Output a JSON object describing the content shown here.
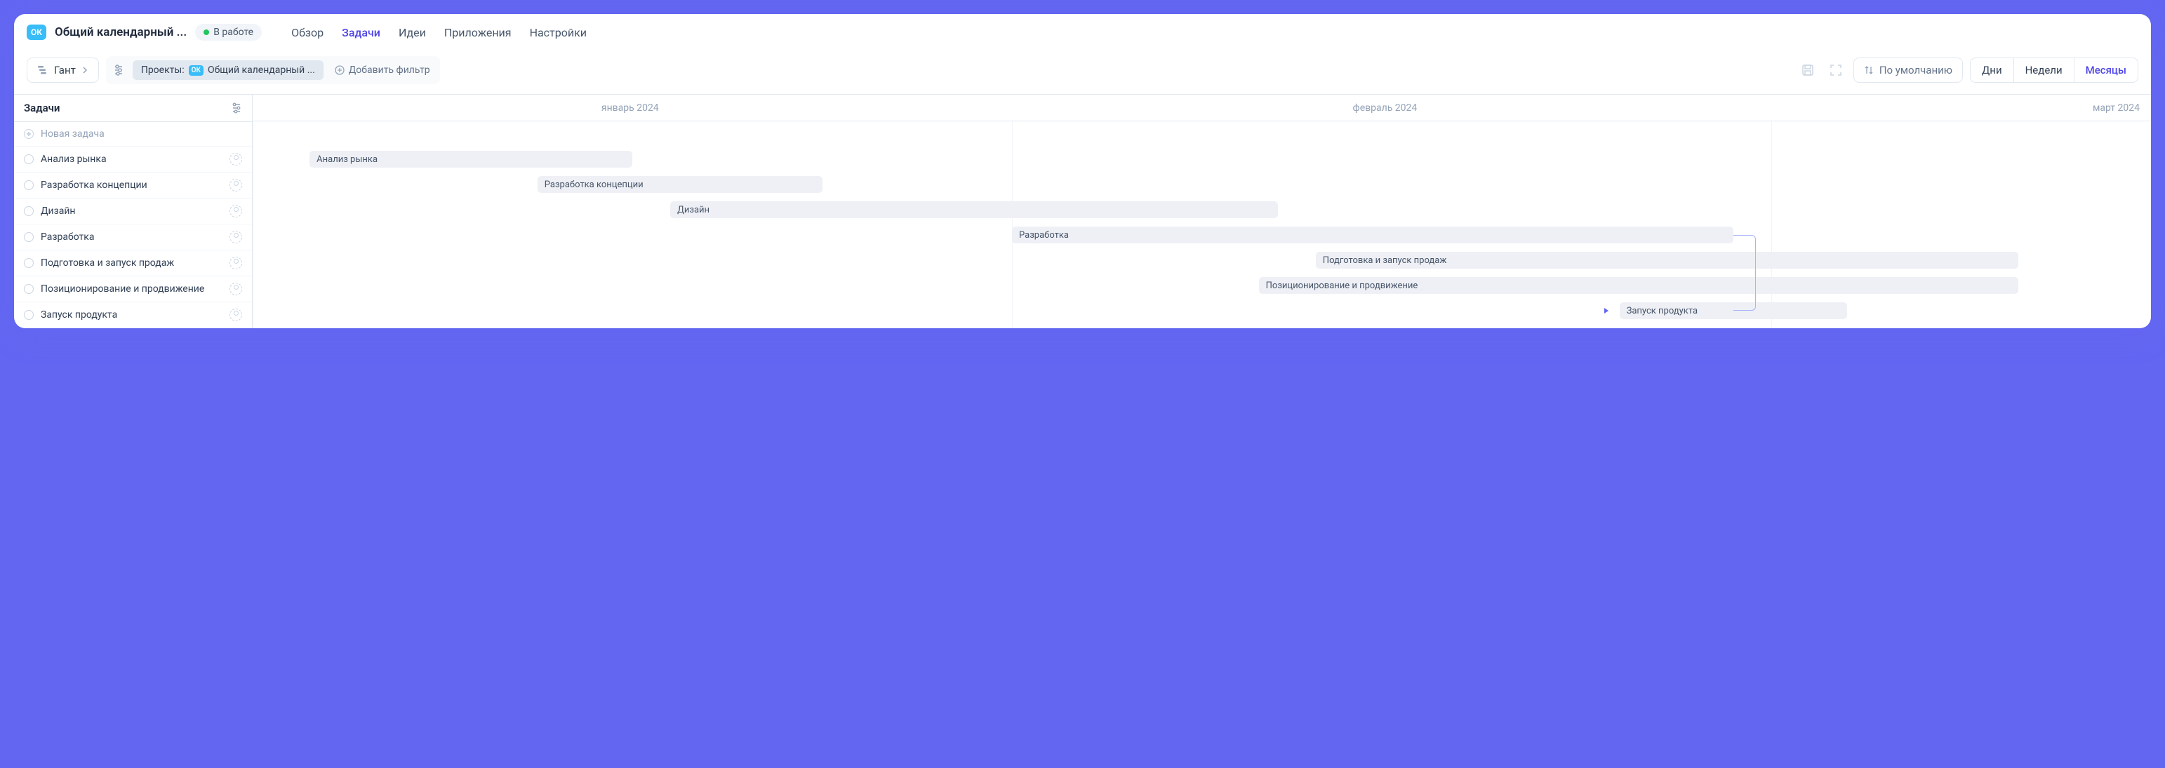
{
  "header": {
    "badge": "ОК",
    "title": "Общий календарный ...",
    "status": "В работе"
  },
  "nav": {
    "overview": "Обзор",
    "tasks": "Задачи",
    "ideas": "Идеи",
    "apps": "Приложения",
    "settings": "Настройки"
  },
  "toolbar": {
    "view_label": "Гант",
    "projects_label": "Проекты:",
    "project_badge": "ОК",
    "project_name": "Общий календарный ...",
    "add_filter": "Добавить фильтр",
    "sort_label": "По умолчанию",
    "seg_days": "Дни",
    "seg_weeks": "Недели",
    "seg_months": "Месяцы"
  },
  "sidebar": {
    "title": "Задачи",
    "new_task": "Новая задача",
    "tasks": [
      "Анализ рынка",
      "Разработка концепции",
      "Дизайн",
      "Разработка",
      "Подготовка и запуск продаж",
      "Позиционирование и продвижение",
      "Запуск продукта"
    ]
  },
  "timeline": {
    "months": {
      "jan": "январь 2024",
      "feb": "февраль 2024",
      "mar": "март 2024"
    }
  },
  "chart_data": {
    "type": "bar",
    "title": "Гант",
    "xlabel": "",
    "ylabel": "",
    "categories": [
      "январь 2024",
      "февраль 2024",
      "март 2024"
    ],
    "series": [
      {
        "name": "Анализ рынка",
        "start_pct": 3,
        "width_pct": 17
      },
      {
        "name": "Разработка концепции",
        "start_pct": 15,
        "width_pct": 15
      },
      {
        "name": "Дизайн",
        "start_pct": 22,
        "width_pct": 32
      },
      {
        "name": "Разработка",
        "start_pct": 40,
        "width_pct": 38
      },
      {
        "name": "Подготовка и запуск продаж",
        "start_pct": 56,
        "width_pct": 37
      },
      {
        "name": "Позиционирование и продвижение",
        "start_pct": 53,
        "width_pct": 40
      },
      {
        "name": "Запуск продукта",
        "start_pct": 72,
        "width_pct": 12,
        "short_label": "Запуск"
      }
    ]
  }
}
